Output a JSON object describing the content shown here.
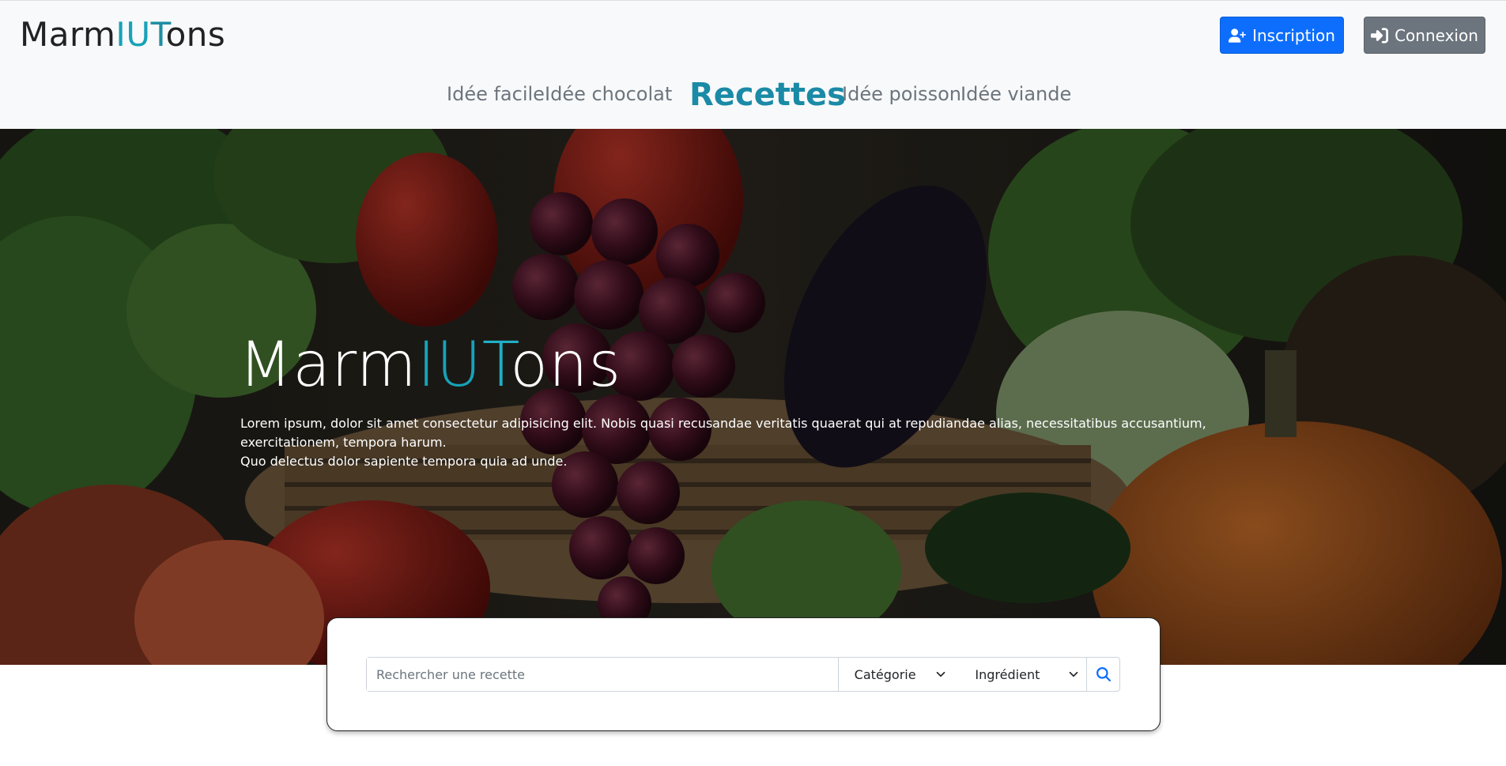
{
  "brand": {
    "part1": "Marm",
    "part2": "I",
    "part3": "U",
    "part4": "T",
    "part5": "ons"
  },
  "header": {
    "signup_label": "Inscription",
    "login_label": "Connexion"
  },
  "nav": {
    "items": [
      "Idée facile",
      "Idée chocolat",
      "Recettes",
      "Idée poisson",
      "Idée viande"
    ]
  },
  "hero": {
    "title": {
      "part1": "Marm",
      "part2": "I",
      "part3": "U",
      "part4": "T",
      "part5": "ons"
    },
    "text_line1": "Lorem ipsum, dolor sit amet consectetur adipisicing elit. Nobis quasi recusandae veritatis quaerat qui at repudiandae alias, necessitatibus accusantium, exercitationem, tempora harum.",
    "text_line2": "Quo delectus dolor sapiente tempora quia ad unde."
  },
  "search": {
    "placeholder": "Rechercher une recette",
    "value": "",
    "category_selected": "Catégorie",
    "ingredient_selected": "Ingrédient"
  },
  "icons": {
    "signup": "user-plus-icon",
    "login": "sign-in-icon",
    "search": "magnifying-glass-icon",
    "dropdown": "chevron-down-icon"
  },
  "colors": {
    "accent": "#17a2b8",
    "primary": "#0d6efd",
    "secondary": "#6c757d",
    "header_bg": "#f8f9fa"
  }
}
